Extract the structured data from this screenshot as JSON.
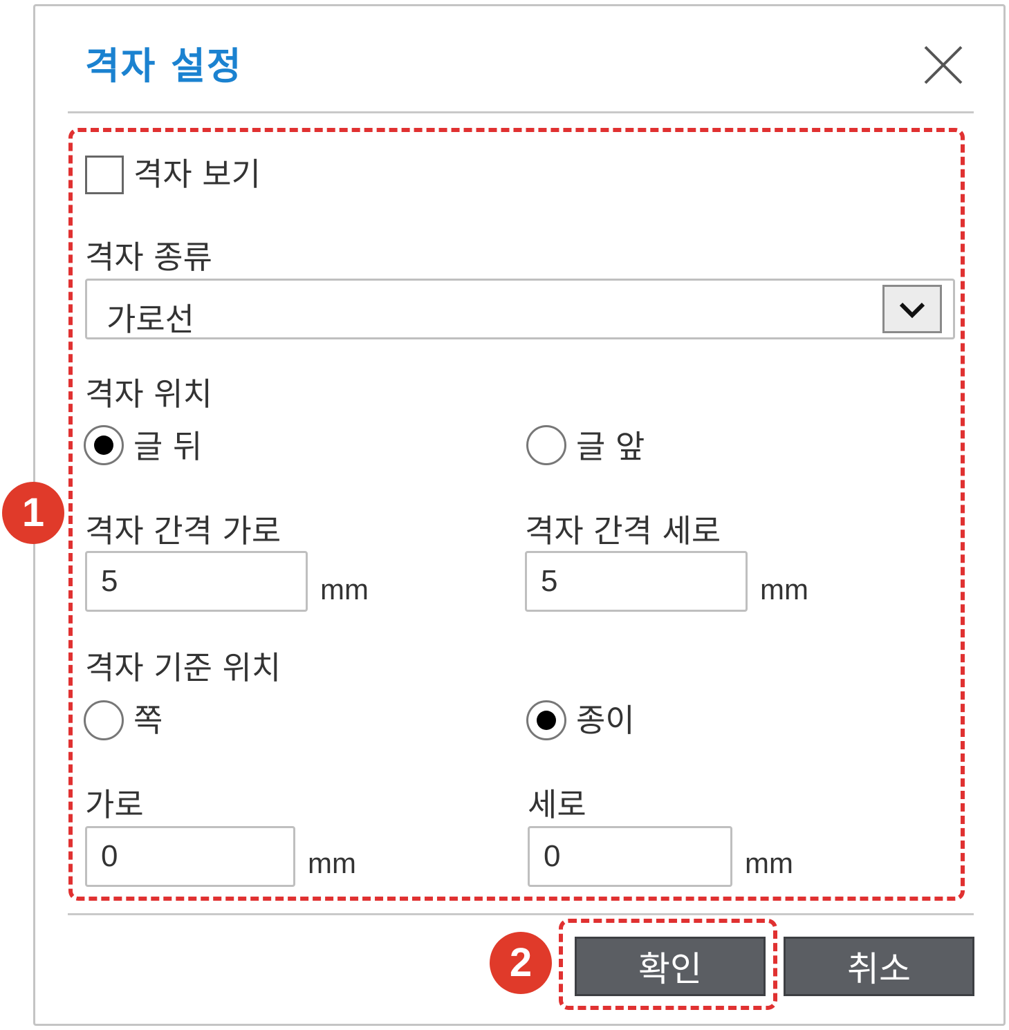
{
  "dialog": {
    "title": "격자 설정",
    "show_grid": {
      "label": "격자 보기",
      "checked": false
    },
    "grid_type": {
      "label": "격자 종류",
      "value": "가로선"
    },
    "grid_position": {
      "label": "격자 위치",
      "options": [
        {
          "label": "글 뒤",
          "checked": true
        },
        {
          "label": "글 앞",
          "checked": false
        }
      ]
    },
    "spacing_horizontal": {
      "label": "격자 간격 가로",
      "value": "5",
      "unit": "mm"
    },
    "spacing_vertical": {
      "label": "격자 간격 세로",
      "value": "5",
      "unit": "mm"
    },
    "reference_position": {
      "label": "격자 기준 위치",
      "options": [
        {
          "label": "쪽",
          "checked": false
        },
        {
          "label": "종이",
          "checked": true
        }
      ]
    },
    "offset_horizontal": {
      "label": "가로",
      "value": "0",
      "unit": "mm"
    },
    "offset_vertical": {
      "label": "세로",
      "value": "0",
      "unit": "mm"
    },
    "buttons": {
      "ok": "확인",
      "cancel": "취소"
    }
  },
  "annotations": {
    "badge_1": "1",
    "badge_2": "2"
  },
  "colors": {
    "title": "#1b82d0",
    "annotation": "#e03131",
    "button": "#5b5e63"
  }
}
